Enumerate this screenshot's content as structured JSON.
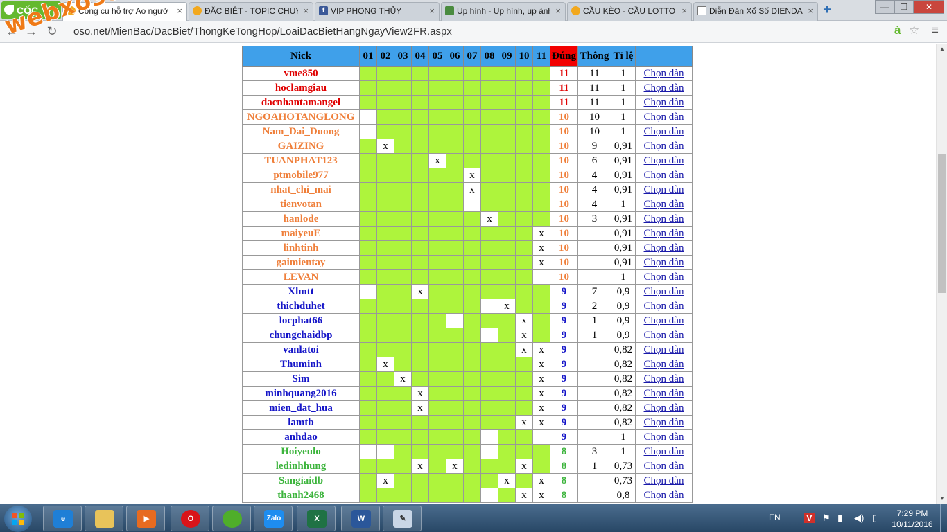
{
  "browser": {
    "brand": "CỐC CỐC",
    "tabs": [
      {
        "title": "Công cụ hỗ trợ Ao ngườ",
        "icon": "xs",
        "active": true
      },
      {
        "title": "ĐẶC BIỆT - TOPIC CHUYÊ",
        "icon": "xs",
        "active": false
      },
      {
        "title": "VIP PHONG THỦY",
        "icon": "facebook",
        "active": false
      },
      {
        "title": "Up hình - Up hình, up ảnh",
        "icon": "picture",
        "active": false
      },
      {
        "title": "CẦU KÈO - CẦU LOTTO",
        "icon": "xs",
        "active": false
      },
      {
        "title": "Diễn Đàn Xổ Số DIENDA",
        "icon": "document",
        "active": false
      }
    ],
    "url": "oso.net/MienBac/DacBiet/ThongKeTongHop/LoaiDacBietHangNgayView2FR.aspx",
    "watermark": "webxoso.net"
  },
  "table": {
    "headers": {
      "nick": "Nick",
      "nums": [
        "01",
        "02",
        "03",
        "04",
        "05",
        "06",
        "07",
        "08",
        "09",
        "10",
        "11"
      ],
      "dung": "Đúng",
      "thong": "Thông",
      "tile": "Tỉ lệ"
    },
    "link_label": "Chọn dàn",
    "mark": "x",
    "group_colors": {
      "11": "#e00000",
      "10": "#ef7f3a",
      "9": "#1515c8",
      "8": "#3cb43c"
    },
    "rows": [
      {
        "nick": "vme850",
        "cells": "ggggggggggg",
        "dung": "11",
        "thong": "11",
        "tile": "1"
      },
      {
        "nick": "hoclamgiau",
        "cells": "ggggggggggg",
        "dung": "11",
        "thong": "11",
        "tile": "1"
      },
      {
        "nick": "dacnhantamangel",
        "cells": "ggggggggggg",
        "dung": "11",
        "thong": "11",
        "tile": "1"
      },
      {
        "nick": "NGOAHOTANGLONG",
        "cells": "wgggggggggg",
        "dung": "10",
        "thong": "10",
        "tile": "1"
      },
      {
        "nick": "Nam_Dai_Duong",
        "cells": "wgggggggggg",
        "dung": "10",
        "thong": "10",
        "tile": "1"
      },
      {
        "nick": "GAIZING",
        "cells": "gxggggggggg",
        "dung": "10",
        "thong": "9",
        "tile": "0,91"
      },
      {
        "nick": "TUANPHAT123",
        "cells": "ggggxgggggg",
        "dung": "10",
        "thong": "6",
        "tile": "0,91"
      },
      {
        "nick": "ptmobile977",
        "cells": "ggggggxgggg",
        "dung": "10",
        "thong": "4",
        "tile": "0,91"
      },
      {
        "nick": "nhat_chi_mai",
        "cells": "ggggggxgggg",
        "dung": "10",
        "thong": "4",
        "tile": "0,91"
      },
      {
        "nick": "tienvotan",
        "cells": "ggggggwgggg",
        "dung": "10",
        "thong": "4",
        "tile": "1"
      },
      {
        "nick": "hanlode",
        "cells": "gggggggxggg",
        "dung": "10",
        "thong": "3",
        "tile": "0,91"
      },
      {
        "nick": "maiyeuE",
        "cells": "ggggggggggx",
        "dung": "10",
        "thong": "",
        "tile": "0,91"
      },
      {
        "nick": "linhtinh",
        "cells": "ggggggggggx",
        "dung": "10",
        "thong": "",
        "tile": "0,91"
      },
      {
        "nick": "gaimientay",
        "cells": "ggggggggggx",
        "dung": "10",
        "thong": "",
        "tile": "0,91"
      },
      {
        "nick": "LEVAN",
        "cells": "ggggggggggw",
        "dung": "10",
        "thong": "",
        "tile": "1"
      },
      {
        "nick": "Xlmtt",
        "cells": "wggxggggggg",
        "dung": "9",
        "thong": "7",
        "tile": "0,9"
      },
      {
        "nick": "thichduhet",
        "cells": "gggggggwxgg",
        "dung": "9",
        "thong": "2",
        "tile": "0,9"
      },
      {
        "nick": "locphat66",
        "cells": "gggggwgggxg",
        "dung": "9",
        "thong": "1",
        "tile": "0,9"
      },
      {
        "nick": "chungchaidbp",
        "cells": "gggggggwgxg",
        "dung": "9",
        "thong": "1",
        "tile": "0,9"
      },
      {
        "nick": "vanlatoi",
        "cells": "gggggggggxx",
        "dung": "9",
        "thong": "",
        "tile": "0,82"
      },
      {
        "nick": "Thuminh",
        "cells": "gxggggggggx",
        "dung": "9",
        "thong": "",
        "tile": "0,82"
      },
      {
        "nick": "Sim",
        "cells": "ggxgggggggx",
        "dung": "9",
        "thong": "",
        "tile": "0,82"
      },
      {
        "nick": "minhquang2016",
        "cells": "gggxgggggg x",
        "dung": "9",
        "thong": "",
        "tile": "0,82"
      },
      {
        "nick": "mien_dat_hua",
        "cells": "gggxggggggx",
        "dung": "9",
        "thong": "",
        "tile": "0,82"
      },
      {
        "nick": "lamtb",
        "cells": "gggggggggxx",
        "dung": "9",
        "thong": "",
        "tile": "0,82"
      },
      {
        "nick": "anhdao",
        "cells": "gggggggwggw",
        "dung": "9",
        "thong": "",
        "tile": "1"
      },
      {
        "nick": "Hoiyeulo",
        "cells": "wwgggggwggg",
        "dung": "8",
        "thong": "3",
        "tile": "1"
      },
      {
        "nick": "ledinhhung",
        "cells": "gggxgxgggxg",
        "dung": "8",
        "thong": "1",
        "tile": "0,73"
      },
      {
        "nick": "Sangiaidb",
        "cells": "gxggggggxgx",
        "dung": "8",
        "thong": "",
        "tile": "0,73"
      },
      {
        "nick": "thanh2468",
        "cells": "gggggggwgxx",
        "dung": "8",
        "thong": "",
        "tile": "0,8"
      }
    ]
  },
  "taskbar": {
    "apps": [
      "internet-explorer",
      "file-explorer",
      "media-player",
      "opera",
      "coccoc",
      "zalo",
      "excel",
      "word",
      "paint"
    ],
    "zalo_label": "Zalo",
    "lang": "EN",
    "time": "7:29 PM",
    "date": "10/11/2016"
  }
}
